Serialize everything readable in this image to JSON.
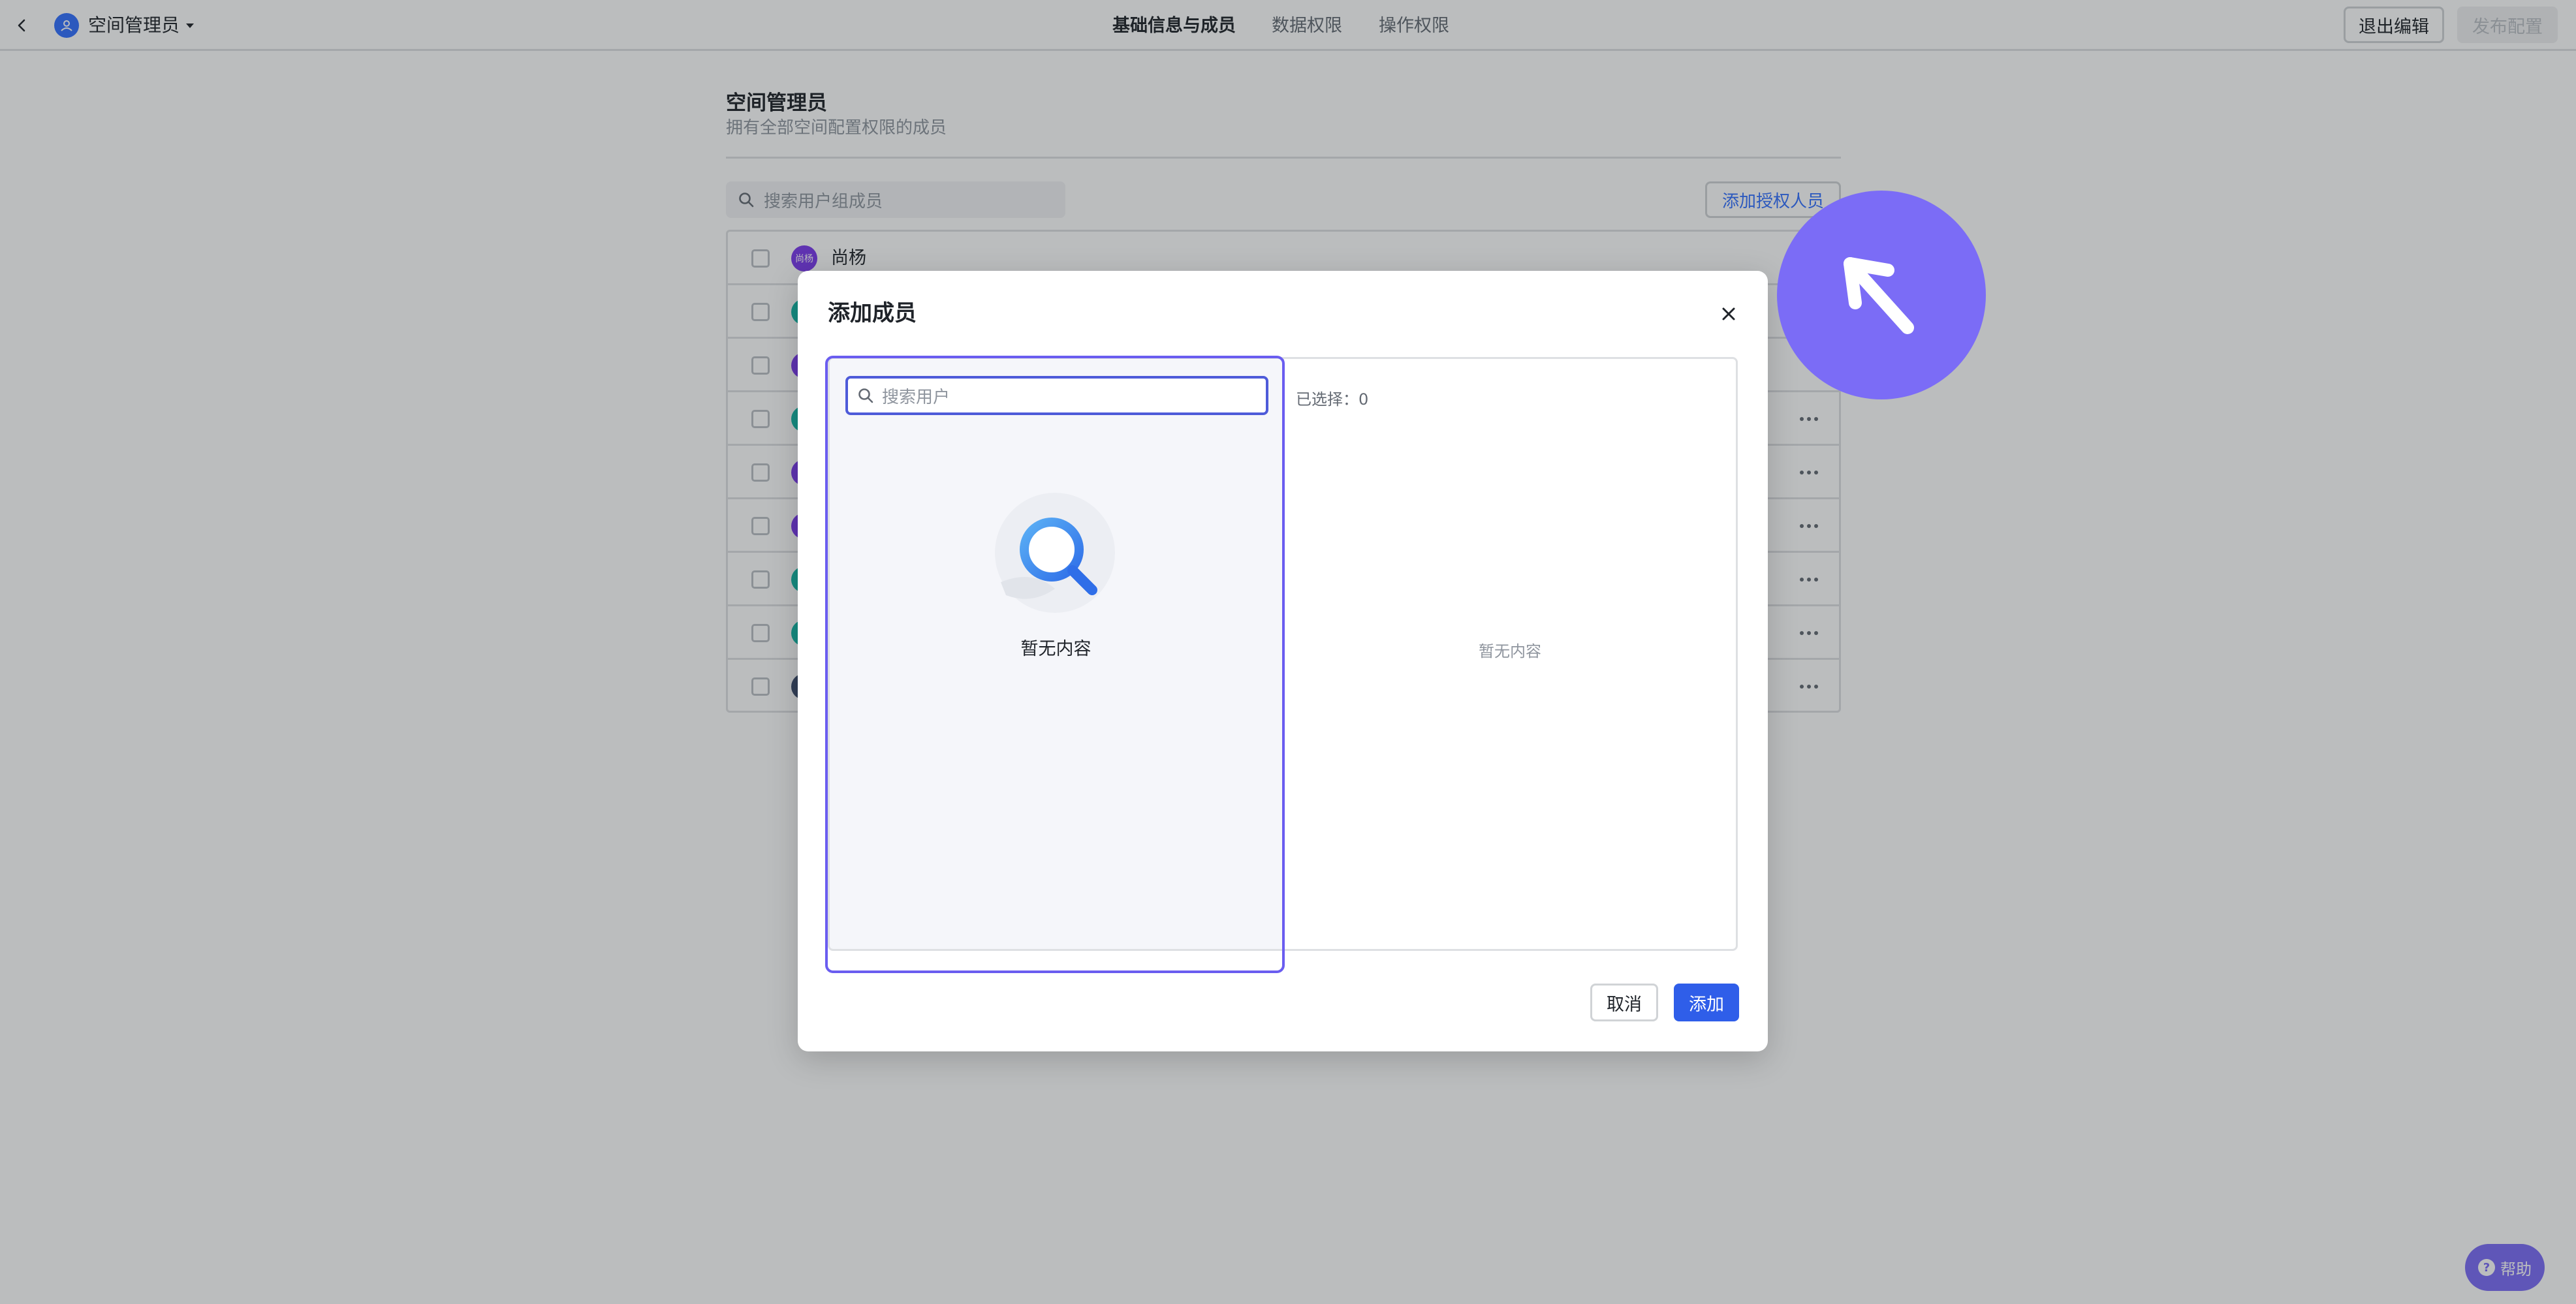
{
  "topbar": {
    "space_name": "空间管理员",
    "tabs": [
      {
        "label": "基础信息与成员",
        "active": true
      },
      {
        "label": "数据权限",
        "active": false
      },
      {
        "label": "操作权限",
        "active": false
      }
    ],
    "exit_label": "退出编辑",
    "publish_label": "发布配置"
  },
  "section": {
    "title": "空间管理员",
    "subtitle": "拥有全部空间配置权限的成员",
    "search_placeholder": "搜索用户组成员",
    "add_button": "添加授权人员"
  },
  "members": [
    {
      "name": "尚杨",
      "avatar_text": "尚杨",
      "color": "#7c3aed"
    },
    {
      "name": "",
      "avatar_text": "",
      "color": "#14b8a6"
    },
    {
      "name": "",
      "avatar_text": "",
      "color": "#7c3aed"
    },
    {
      "name": "",
      "avatar_text": "",
      "color": "#14b8a6"
    },
    {
      "name": "",
      "avatar_text": "",
      "color": "#7c3aed"
    },
    {
      "name": "",
      "avatar_text": "",
      "color": "#7c3aed"
    },
    {
      "name": "",
      "avatar_text": "",
      "color": "#14b8a6"
    },
    {
      "name": "",
      "avatar_text": "",
      "color": "#14b8a6"
    },
    {
      "name": "",
      "avatar_text": "",
      "color": "#3b4b6b"
    }
  ],
  "modal": {
    "title": "添加成员",
    "search_placeholder": "搜索用户",
    "empty_left": "暂无内容",
    "selected_label": "已选择：0",
    "empty_right": "暂无内容",
    "cancel_label": "取消",
    "confirm_label": "添加"
  },
  "help": {
    "label": "帮助"
  },
  "colors": {
    "accent": "#3370ff",
    "primary_button": "#2f5ee9",
    "highlight": "#6a5df0",
    "cue": "#7b6cf6"
  }
}
